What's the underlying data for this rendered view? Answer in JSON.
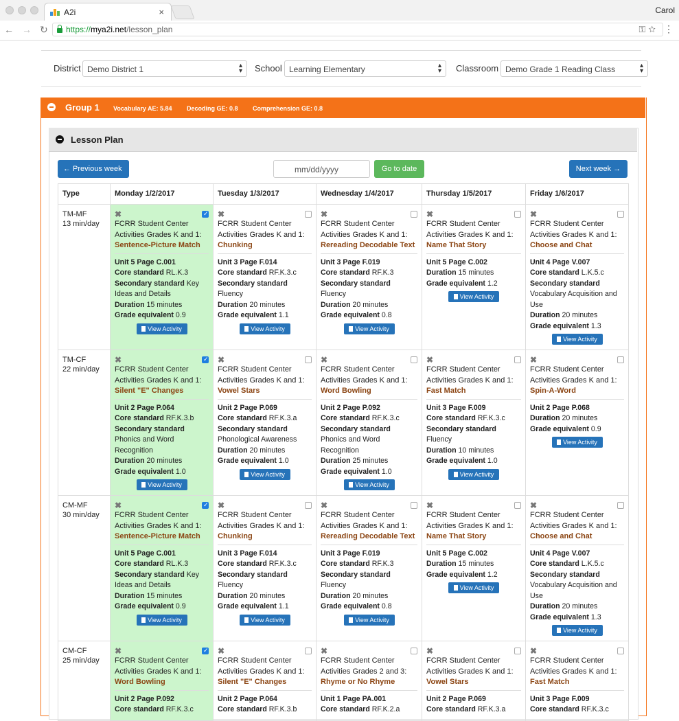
{
  "browser": {
    "tab_title": "A2i",
    "user": "Carol",
    "url_https": "https://",
    "url_host": "mya2i.net",
    "url_path": "/lesson_plan"
  },
  "filters": {
    "district_label": "District",
    "district_value": "Demo District 1",
    "school_label": "School",
    "school_value": "Learning Elementary",
    "classroom_label": "Classroom",
    "classroom_value": "Demo Grade 1 Reading Class"
  },
  "group": {
    "title": "Group 1",
    "vocab": "Vocabulary AE: 5.84",
    "decoding": "Decoding GE: 0.8",
    "comprehension": "Comprehension GE: 0.8",
    "accent": "#f47218"
  },
  "lesson_plan": {
    "title": "Lesson Plan",
    "prev_label": "← Previous week",
    "next_label": "Next week →",
    "date_placeholder": "mm/dd/yyyy",
    "go_label": "Go to date",
    "view_label": "View Activity"
  },
  "table": {
    "headers": [
      "Type",
      "Monday 1/2/2017",
      "Tuesday 1/3/2017",
      "Wednesday 1/4/2017",
      "Thursday 1/5/2017",
      "Friday 1/6/2017"
    ],
    "rows": [
      {
        "type": "TM-MF",
        "mins": "13 min/day",
        "cells": [
          {
            "source": "FCRR Student Center Activities Grades K and 1:",
            "activity": "Sentence-Picture Match",
            "unit": "Unit 5 Page C.001",
            "core": "RL.K.3",
            "secondary": "Key Ideas and Details",
            "duration": "15 minutes",
            "grade": "0.9"
          },
          {
            "source": "FCRR Student Center Activities Grades K and 1:",
            "activity": "Chunking",
            "unit": "Unit 3 Page F.014",
            "core": "RF.K.3.c",
            "secondary": "Fluency",
            "duration": "20 minutes",
            "grade": "1.1"
          },
          {
            "source": "FCRR Student Center Activities Grades K and 1:",
            "activity": "Rereading Decodable Text",
            "unit": "Unit 3 Page F.019",
            "core": "RF.K.3",
            "secondary": "Fluency",
            "duration": "20 minutes",
            "grade": "0.8"
          },
          {
            "source": "FCRR Student Center Activities Grades K and 1:",
            "activity": "Name That Story",
            "unit": "Unit 5 Page C.002",
            "duration": "15 minutes",
            "grade": "1.2"
          },
          {
            "source": "FCRR Student Center Activities Grades K and 1:",
            "activity": "Choose and Chat",
            "unit": "Unit 4 Page V.007",
            "core": "L.K.5.c",
            "secondary": "Vocabulary Acquisition and Use",
            "duration": "20 minutes",
            "grade": "1.3"
          }
        ]
      },
      {
        "type": "TM-CF",
        "mins": "22 min/day",
        "cells": [
          {
            "source": "FCRR Student Center Activities Grades K and 1:",
            "activity": "Silent \"E\" Changes",
            "unit": "Unit 2 Page P.064",
            "core": "RF.K.3.b",
            "secondary": "Phonics and Word Recognition",
            "duration": "20 minutes",
            "grade": "1.0"
          },
          {
            "source": "FCRR Student Center Activities Grades K and 1:",
            "activity": "Vowel Stars",
            "unit": "Unit 2 Page P.069",
            "core": "RF.K.3.a",
            "secondary": "Phonological Awareness",
            "duration": "20 minutes",
            "grade": "1.0"
          },
          {
            "source": "FCRR Student Center Activities Grades K and 1:",
            "activity": "Word Bowling",
            "unit": "Unit 2 Page P.092",
            "core": "RF.K.3.c",
            "secondary": "Phonics and Word Recognition",
            "duration": "25 minutes",
            "grade": "1.0"
          },
          {
            "source": "FCRR Student Center Activities Grades K and 1:",
            "activity": "Fast Match",
            "unit": "Unit 3 Page F.009",
            "core": "RF.K.3.c",
            "secondary": "Fluency",
            "duration": "10 minutes",
            "grade": "1.0"
          },
          {
            "source": "FCRR Student Center Activities Grades K and 1:",
            "activity": "Spin-A-Word",
            "unit": "Unit 2 Page P.068",
            "duration": "20 minutes",
            "grade": "0.9"
          }
        ]
      },
      {
        "type": "CM-MF",
        "mins": "30 min/day",
        "cells": [
          {
            "source": "FCRR Student Center Activities Grades K and 1:",
            "activity": "Sentence-Picture Match",
            "unit": "Unit 5 Page C.001",
            "core": "RL.K.3",
            "secondary": "Key Ideas and Details",
            "duration": "15 minutes",
            "grade": "0.9"
          },
          {
            "source": "FCRR Student Center Activities Grades K and 1:",
            "activity": "Chunking",
            "unit": "Unit 3 Page F.014",
            "core": "RF.K.3.c",
            "secondary": "Fluency",
            "duration": "20 minutes",
            "grade": "1.1"
          },
          {
            "source": "FCRR Student Center Activities Grades K and 1:",
            "activity": "Rereading Decodable Text",
            "unit": "Unit 3 Page F.019",
            "core": "RF.K.3",
            "secondary": "Fluency",
            "duration": "20 minutes",
            "grade": "0.8"
          },
          {
            "source": "FCRR Student Center Activities Grades K and 1:",
            "activity": "Name That Story",
            "unit": "Unit 5 Page C.002",
            "duration": "15 minutes",
            "grade": "1.2"
          },
          {
            "source": "FCRR Student Center Activities Grades K and 1:",
            "activity": "Choose and Chat",
            "unit": "Unit 4 Page V.007",
            "core": "L.K.5.c",
            "secondary": "Vocabulary Acquisition and Use",
            "duration": "20 minutes",
            "grade": "1.3"
          }
        ]
      },
      {
        "type": "CM-CF",
        "mins": "25 min/day",
        "cells": [
          {
            "source": "FCRR Student Center Activities Grades K and 1:",
            "activity": "Word Bowling",
            "unit": "Unit 2 Page P.092",
            "core": "RF.K.3.c"
          },
          {
            "source": "FCRR Student Center Activities Grades K and 1:",
            "activity": "Silent \"E\" Changes",
            "unit": "Unit 2 Page P.064",
            "core": "RF.K.3.b"
          },
          {
            "source": "FCRR Student Center Activities Grades 2 and 3:",
            "activity": "Rhyme or No Rhyme",
            "unit": "Unit 1 Page PA.001",
            "core": "RF.K.2.a"
          },
          {
            "source": "FCRR Student Center Activities Grades K and 1:",
            "activity": "Vowel Stars",
            "unit": "Unit 2 Page P.069",
            "core": "RF.K.3.a"
          },
          {
            "source": "FCRR Student Center Activities Grades K and 1:",
            "activity": "Fast Match",
            "unit": "Unit 3 Page F.009",
            "core": "RF.K.3.c"
          }
        ]
      }
    ]
  }
}
